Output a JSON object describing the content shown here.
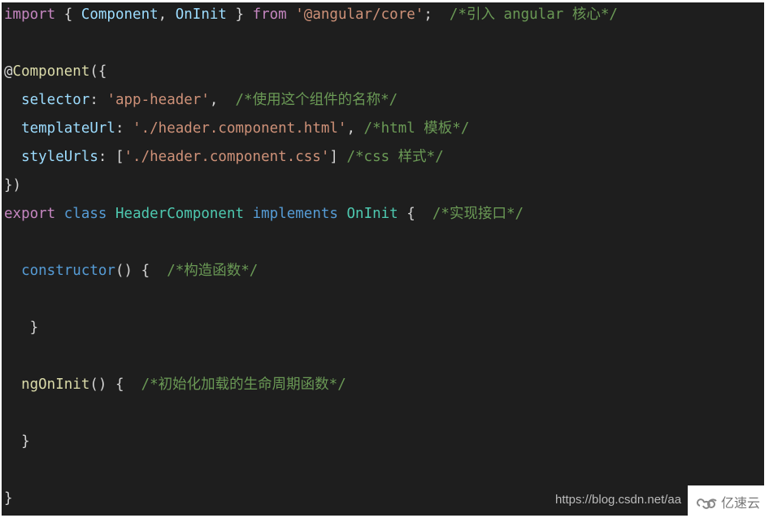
{
  "code_editor": {
    "theme": "dark",
    "background": "#1e1e1e",
    "lines": [
      {
        "tokens": [
          {
            "t": "import",
            "c": "kw"
          },
          {
            "t": " { ",
            "c": "pun"
          },
          {
            "t": "Component",
            "c": "id"
          },
          {
            "t": ", ",
            "c": "pun"
          },
          {
            "t": "OnInit",
            "c": "id"
          },
          {
            "t": " } ",
            "c": "pun"
          },
          {
            "t": "from",
            "c": "kw"
          },
          {
            "t": " ",
            "c": "pun"
          },
          {
            "t": "'@angular/core'",
            "c": "str"
          },
          {
            "t": ";  ",
            "c": "pun"
          },
          {
            "t": "/*引入 angular 核心*/",
            "c": "cm"
          }
        ]
      },
      {
        "tokens": []
      },
      {
        "tokens": [
          {
            "t": "@",
            "c": "pun"
          },
          {
            "t": "Component",
            "c": "fn"
          },
          {
            "t": "({",
            "c": "pun"
          }
        ]
      },
      {
        "tokens": [
          {
            "t": "  ",
            "c": "pun"
          },
          {
            "t": "selector",
            "c": "id"
          },
          {
            "t": ": ",
            "c": "pun"
          },
          {
            "t": "'app-header'",
            "c": "str"
          },
          {
            "t": ",  ",
            "c": "pun"
          },
          {
            "t": "/*使用这个组件的名称*/",
            "c": "cm"
          }
        ]
      },
      {
        "tokens": [
          {
            "t": "  ",
            "c": "pun"
          },
          {
            "t": "templateUrl",
            "c": "id"
          },
          {
            "t": ": ",
            "c": "pun"
          },
          {
            "t": "'./header.component.html'",
            "c": "str"
          },
          {
            "t": ", ",
            "c": "pun"
          },
          {
            "t": "/*html 模板*/",
            "c": "cm"
          }
        ]
      },
      {
        "tokens": [
          {
            "t": "  ",
            "c": "pun"
          },
          {
            "t": "styleUrls",
            "c": "id"
          },
          {
            "t": ": [",
            "c": "pun"
          },
          {
            "t": "'./header.component.css'",
            "c": "str"
          },
          {
            "t": "] ",
            "c": "pun"
          },
          {
            "t": "/*css 样式*/",
            "c": "cm"
          }
        ]
      },
      {
        "tokens": [
          {
            "t": "})",
            "c": "pun"
          }
        ]
      },
      {
        "tokens": [
          {
            "t": "export",
            "c": "kw"
          },
          {
            "t": " ",
            "c": "pun"
          },
          {
            "t": "class",
            "c": "kw2"
          },
          {
            "t": " ",
            "c": "pun"
          },
          {
            "t": "HeaderComponent",
            "c": "cls"
          },
          {
            "t": " ",
            "c": "pun"
          },
          {
            "t": "implements",
            "c": "kw2"
          },
          {
            "t": " ",
            "c": "pun"
          },
          {
            "t": "OnInit",
            "c": "cls"
          },
          {
            "t": " {  ",
            "c": "pun"
          },
          {
            "t": "/*实现接口*/",
            "c": "cm"
          }
        ]
      },
      {
        "tokens": []
      },
      {
        "tokens": [
          {
            "t": "  ",
            "c": "pun"
          },
          {
            "t": "constructor",
            "c": "kw2"
          },
          {
            "t": "() {  ",
            "c": "pun"
          },
          {
            "t": "/*构造函数*/",
            "c": "cm"
          }
        ]
      },
      {
        "tokens": []
      },
      {
        "tokens": [
          {
            "t": "   }",
            "c": "pun"
          }
        ]
      },
      {
        "tokens": []
      },
      {
        "tokens": [
          {
            "t": "  ",
            "c": "pun"
          },
          {
            "t": "ngOnInit",
            "c": "fn"
          },
          {
            "t": "() {  ",
            "c": "pun"
          },
          {
            "t": "/*初始化加载的生命周期函数*/",
            "c": "cm"
          }
        ]
      },
      {
        "tokens": []
      },
      {
        "tokens": [
          {
            "t": "  }",
            "c": "pun"
          }
        ]
      },
      {
        "tokens": []
      },
      {
        "tokens": [
          {
            "t": "}",
            "c": "pun"
          }
        ]
      }
    ]
  },
  "watermark": {
    "url_text": "https://blog.csdn.net/aa",
    "badge_icon": "cloud-logo-icon",
    "badge_text": "亿速云"
  }
}
